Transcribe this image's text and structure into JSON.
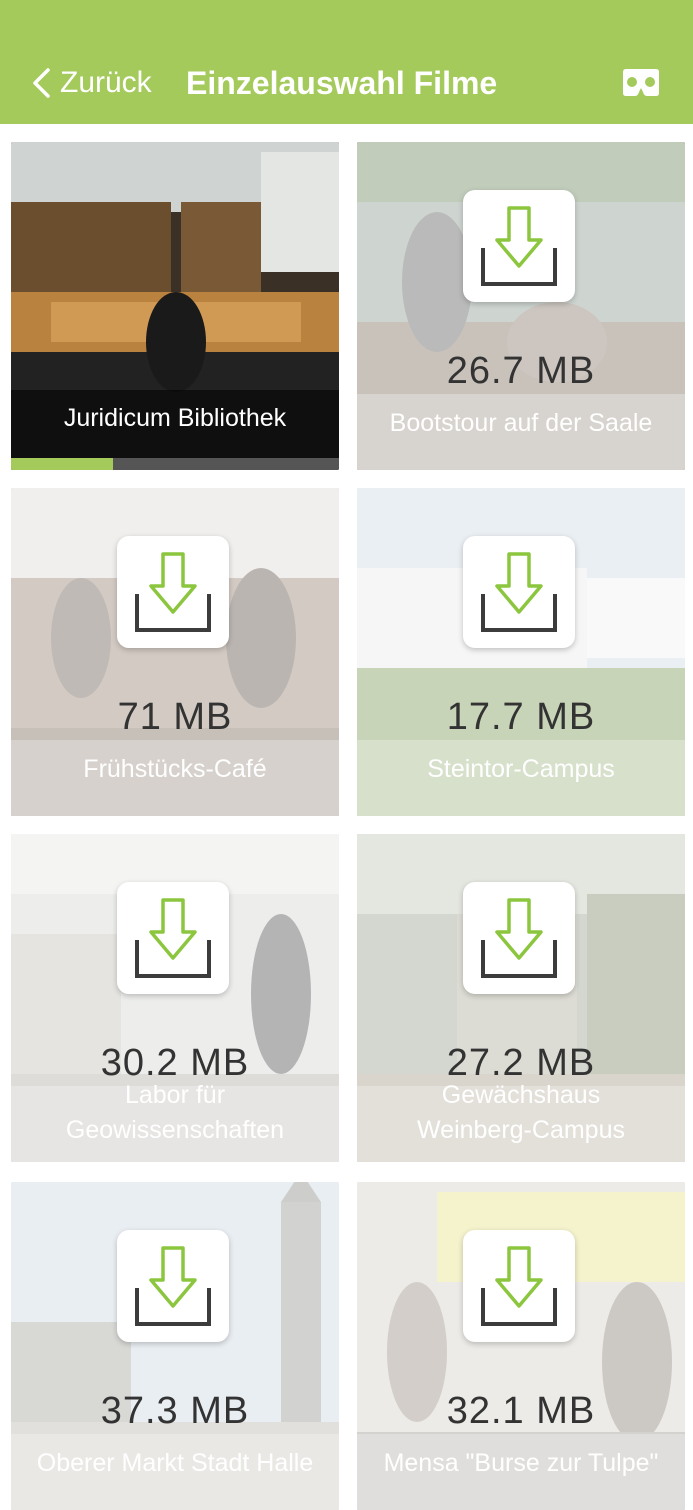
{
  "header": {
    "back_label": "Zurück",
    "title": "Einzelauswahl Filme",
    "vr_icon": "vr-headset-icon",
    "color": "#a5ca5c"
  },
  "tiles": [
    {
      "name": "Juridicum Bibliothek",
      "progress": 0.31,
      "status": "downloading"
    },
    {
      "name": "Bootstour auf der Saale",
      "size": "26.7 MB"
    },
    {
      "name": "Frühstücks-Café",
      "size": "71 MB"
    },
    {
      "name": "Steintor-Campus",
      "size": "17.7 MB"
    },
    {
      "name_line1": "Labor für",
      "name_line2": "Geowissenschaften",
      "size": "30.2 MB"
    },
    {
      "name_line1": "Gewächshaus",
      "name_line2": "Weinberg-Campus",
      "size": "27.2 MB"
    },
    {
      "name": "Oberer Markt Stadt Halle",
      "size": "37.3 MB"
    },
    {
      "name": "Mensa \"Burse zur Tulpe\"",
      "size": "32.1 MB"
    }
  ],
  "icons": {
    "download": "download-icon",
    "back": "chevron-left-icon"
  }
}
